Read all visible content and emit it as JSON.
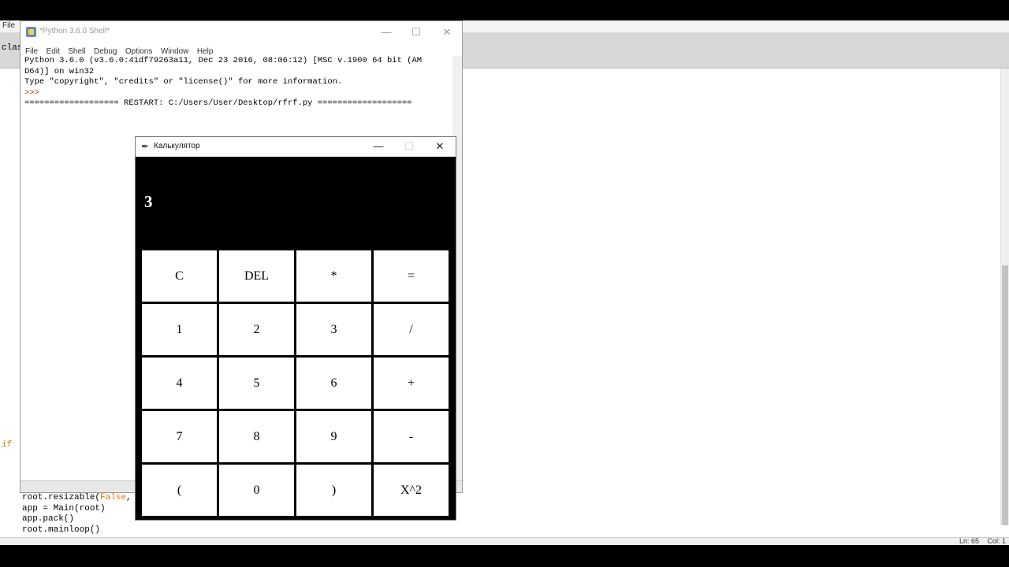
{
  "background_editor": {
    "menu_file": "File",
    "left_fragments": [
      "clas",
      "if"
    ],
    "code_lines": [
      {
        "pre": "root.resizable(",
        "kw": "False",
        "post": ","
      },
      {
        "pre": "app = Main(root)",
        "kw": "",
        "post": ""
      },
      {
        "pre": "app.pack()",
        "kw": "",
        "post": ""
      },
      {
        "pre": "root.mainloop()",
        "kw": "",
        "post": ""
      }
    ],
    "status": {
      "line": "Ln: 65",
      "col": "Col: 1"
    }
  },
  "shell": {
    "title": "*Python 3.6.0 Shell*",
    "menu": [
      "File",
      "Edit",
      "Shell",
      "Debug",
      "Options",
      "Window",
      "Help"
    ],
    "lines": [
      "Python 3.6.0 (v3.6.0:41df79263a11, Dec 23 2016, 08:06:12) [MSC v.1900 64 bit (AM",
      "D64)] on win32",
      "Type \"copyright\", \"credits\" or \"license()\" for more information."
    ],
    "prompt": ">>>",
    "restart_line": "=================== RESTART: C:/Users/User/Desktop/rfrf.py ==================="
  },
  "window_controls": {
    "minimize": "—",
    "maximize": "☐",
    "close": "✕"
  },
  "calculator": {
    "title": "Калькулятор",
    "display": "3",
    "keys": [
      [
        "C",
        "DEL",
        "*",
        "="
      ],
      [
        "1",
        "2",
        "3",
        "/"
      ],
      [
        "4",
        "5",
        "6",
        "+"
      ],
      [
        "7",
        "8",
        "9",
        "-"
      ],
      [
        "(",
        "0",
        ")",
        "X^2"
      ]
    ]
  }
}
